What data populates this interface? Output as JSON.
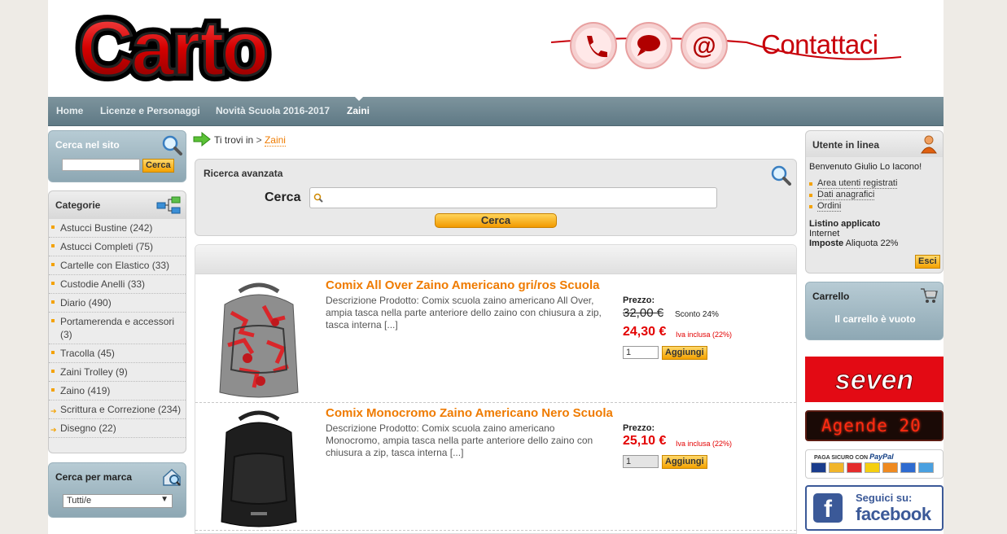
{
  "brand": {
    "logo_text": "Carto",
    "contact_label": "Contattaci"
  },
  "nav": {
    "items": [
      {
        "label": "Home"
      },
      {
        "label": "Licenze e Personaggi"
      },
      {
        "label": "Novità Scuola 2016-2017"
      },
      {
        "label": "Zaini"
      }
    ],
    "active": "Zaini"
  },
  "site_search": {
    "title": "Cerca nel sito",
    "button": "Cerca",
    "value": ""
  },
  "categories": {
    "title": "Categorie",
    "items": [
      {
        "label": "Astucci Bustine (242)"
      },
      {
        "label": "Astucci Completi (75)"
      },
      {
        "label": "Cartelle con Elastico (33)"
      },
      {
        "label": "Custodie Anelli (33)"
      },
      {
        "label": "Diario (490)"
      },
      {
        "label": "Portamerenda e accessori (3)"
      },
      {
        "label": "Tracolla (45)"
      },
      {
        "label": "Zaini Trolley (9)"
      },
      {
        "label": "Zaino (419)"
      },
      {
        "label": "Scrittura e Correzione (234)"
      },
      {
        "label": "Disegno (22)"
      }
    ]
  },
  "brand_search": {
    "title": "Cerca per marca",
    "selected": "Tutti/e"
  },
  "breadcrumb": {
    "prefix": "Ti trovi in",
    "separator": ">",
    "current": "Zaini"
  },
  "advanced_search": {
    "title": "Ricerca avanzata",
    "label": "Cerca",
    "value": "",
    "button": "Cerca"
  },
  "products": [
    {
      "title": "Comix All Over Zaino Americano gri/ros Scuola",
      "description": "Descrizione Prodotto: Comix scuola zaino americano All Over, ampia tasca nella parte anteriore dello zaino con chiusura a zip, tasca interna [...]",
      "price_label": "Prezzo:",
      "old_price": "32,00 €",
      "discount": "Sconto 24%",
      "price": "24,30 €",
      "vat": "Iva inclusa (22%)",
      "qty": "1",
      "add_label": "Aggiungi"
    },
    {
      "title": "Comix Monocromo Zaino Americano Nero Scuola",
      "description": "Descrizione Prodotto: Comix scuola zaino americano Monocromo, ampia tasca nella parte anteriore dello zaino con chiusura a zip, tasca interna [...]",
      "price_label": "Prezzo:",
      "price": "25,10 €",
      "vat": "Iva inclusa (22%)",
      "qty": "1",
      "add_label": "Aggiungi"
    }
  ],
  "user": {
    "title": "Utente in linea",
    "welcome": "Benvenuto Giulio Lo Iacono!",
    "links": [
      "Area utenti registrati",
      "Dati anagrafici",
      "Ordini"
    ],
    "listino_label": "Listino applicato",
    "listino_value": "Internet",
    "imposte_label": "Imposte",
    "imposte_value": "Aliquota 22%",
    "logout": "Esci"
  },
  "cart": {
    "title": "Carrello",
    "empty": "Il carrello è vuoto"
  },
  "banners": {
    "seven": "seven",
    "led": "Agende 20",
    "paypal_prefix": "PAGA SICURO CON",
    "paypal_brand": "PayPal",
    "fb_line1": "Seguici su:",
    "fb_line2": "facebook",
    "fb_letter": "f"
  },
  "colors": {
    "accent": "#ef7b00",
    "price": "#e30000",
    "nav": "#6a838e",
    "button": "#f4a200"
  }
}
